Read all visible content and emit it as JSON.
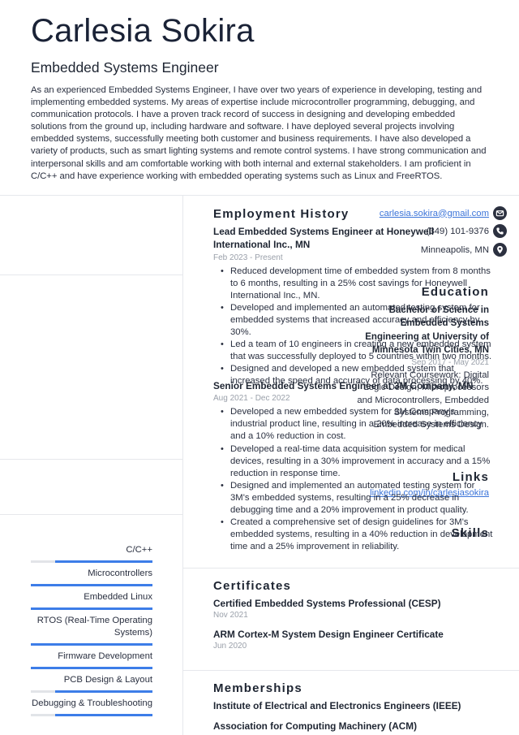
{
  "header": {
    "name": "Carlesia Sokira",
    "title": "Embedded Systems Engineer",
    "summary": "As an experienced Embedded Systems Engineer, I have over two years of experience in developing, testing and implementing embedded systems. My areas of expertise include microcontroller programming, debugging, and communication protocols. I have a proven track record of success in designing and developing embedded solutions from the ground up, including hardware and software. I have deployed several projects involving embedded systems, successfully meeting both customer and business requirements. I have also developed a variety of products, such as smart lighting systems and remote control systems. I have strong communication and interpersonal skills and am comfortable working with both internal and external stakeholders. I am proficient in C/C++ and have experience working with embedded operating systems such as Linux and FreeRTOS."
  },
  "contact": {
    "email": "carlesia.sokira@gmail.com",
    "phone": "(349) 101-9376",
    "location": "Minneapolis, MN",
    "icons": [
      "envelope-icon",
      "phone-icon",
      "map-pin-icon"
    ]
  },
  "education": {
    "heading": "Education",
    "degree": "Bachelor of Science in Embedded Systems Engineering at University of Minnesota Twin Cities, MN",
    "dates": "Sep 2017 - May 2021",
    "description": "Relevant Coursework: Digital Logic Design, Microprocessors and Microcontrollers, Embedded Systems Programming, Embedded Systems Design."
  },
  "links": {
    "heading": "Links",
    "items": [
      {
        "label": "linkedin.com/in/carlesiasokira"
      }
    ]
  },
  "skills": {
    "heading": "Skills",
    "accent_color": "#3d7de8",
    "track_color": "#e2e4e8",
    "items": [
      {
        "name": "C/C++",
        "level": 0.8
      },
      {
        "name": "Microcontrollers",
        "level": 1.0
      },
      {
        "name": "Embedded Linux",
        "level": 1.0
      },
      {
        "name": "RTOS (Real-Time Operating Systems)",
        "level": 1.0
      },
      {
        "name": "Firmware Development",
        "level": 1.0
      },
      {
        "name": "PCB Design & Layout",
        "level": 0.8
      },
      {
        "name": "Debugging & Troubleshooting",
        "level": 0.8
      }
    ]
  },
  "employment": {
    "heading": "Employment History",
    "jobs": [
      {
        "title": "Lead Embedded Systems Engineer at Honeywell International Inc., MN",
        "dates": "Feb 2023 - Present",
        "bullets": [
          "Reduced development time of embedded system from 8 months to 6 months, resulting in a 25% cost savings for Honeywell International Inc., MN.",
          "Developed and implemented an automated testing system for embedded systems that increased accuracy and efficiency by 30%.",
          "Led a team of 10 engineers in creating a new embedded system that was successfully deployed to 5 countries within two months.",
          "Designed and developed a new embedded system that increased the speed and accuracy of data processing by 40%."
        ]
      },
      {
        "title": "Senior Embedded Systems Engineer at 3M Company, MN",
        "dates": "Aug 2021 - Dec 2022",
        "bullets": [
          "Developed a new embedded system for 3M Company's industrial product line, resulting in a 20% increase in efficiency and a 10% reduction in cost.",
          "Developed a real-time data acquisition system for medical devices, resulting in a 30% improvement in accuracy and a 15% reduction in response time.",
          "Designed and implemented an automated testing system for 3M's embedded systems, resulting in a 25% decrease in debugging time and a 20% improvement in product quality.",
          "Created a comprehensive set of design guidelines for 3M's embedded systems, resulting in a 40% reduction in development time and a 25% improvement in reliability."
        ]
      }
    ]
  },
  "certificates": {
    "heading": "Certificates",
    "items": [
      {
        "name": "Certified Embedded Systems Professional (CESP)",
        "date": "Nov 2021"
      },
      {
        "name": "ARM Cortex-M System Design Engineer Certificate",
        "date": "Jun 2020"
      }
    ]
  },
  "memberships": {
    "heading": "Memberships",
    "items": [
      "Institute of Electrical and Electronics Engineers (IEEE)",
      "Association for Computing Machinery (ACM)"
    ]
  }
}
